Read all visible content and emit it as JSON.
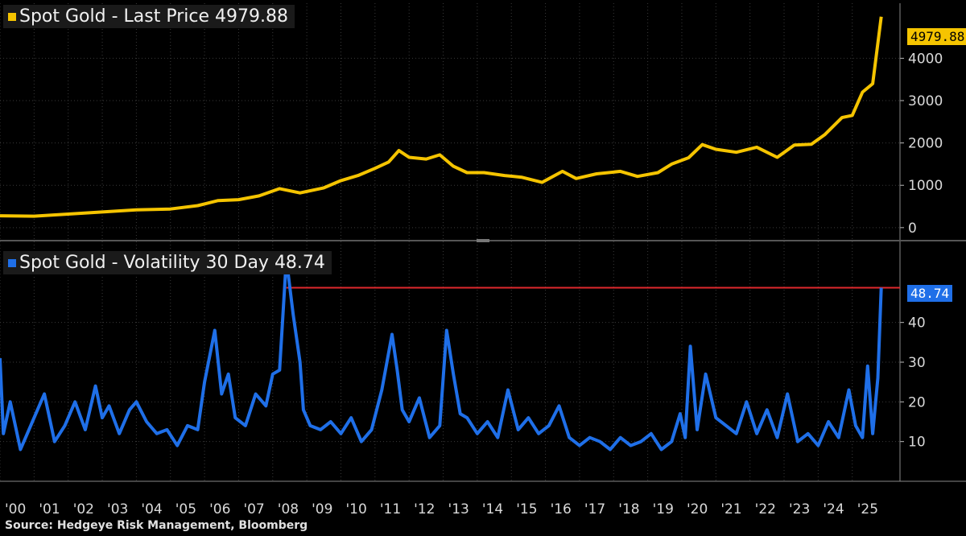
{
  "source_text": "Source: Hedgeye Risk Management, Bloomberg",
  "colors": {
    "background": "#000000",
    "gold": "#f5c400",
    "blue": "#1f6fe8",
    "reference_line": "#e0282d",
    "grid": "#3a3a3a",
    "tick_text": "#d9d9d9"
  },
  "chart_data": [
    {
      "type": "line",
      "legend": "Spot Gold - Last Price 4979.88",
      "last_value_label": "4979.88",
      "ylim": [
        -250,
        5300
      ],
      "yticks": [
        "0",
        "1000",
        "2000",
        "3000",
        "4000"
      ],
      "ytick_values": [
        0,
        1000,
        2000,
        3000,
        4000
      ],
      "series": [
        {
          "x": [
            2000.0,
            2001.0,
            2002.0,
            2003.0,
            2004.0,
            2005.0,
            2005.8,
            2006.4,
            2007.0,
            2007.6,
            2008.2,
            2008.8,
            2009.5,
            2010.0,
            2010.5,
            2011.0,
            2011.4,
            2011.7,
            2012.0,
            2012.5,
            2012.9,
            2013.3,
            2013.7,
            2014.2,
            2014.8,
            2015.3,
            2015.9,
            2016.5,
            2016.9,
            2017.5,
            2018.2,
            2018.7,
            2019.3,
            2019.7,
            2020.2,
            2020.6,
            2021.0,
            2021.6,
            2022.2,
            2022.8,
            2023.3,
            2023.8,
            2024.2,
            2024.7,
            2025.0,
            2025.3,
            2025.6,
            2025.85
          ],
          "values": [
            280,
            270,
            320,
            370,
            420,
            440,
            520,
            640,
            660,
            750,
            920,
            820,
            940,
            1110,
            1230,
            1400,
            1550,
            1820,
            1660,
            1620,
            1720,
            1450,
            1300,
            1300,
            1230,
            1190,
            1070,
            1330,
            1160,
            1270,
            1330,
            1210,
            1300,
            1500,
            1650,
            1960,
            1850,
            1780,
            1900,
            1660,
            1950,
            1970,
            2200,
            2600,
            2650,
            3200,
            3400,
            4979.88
          ]
        }
      ]
    },
    {
      "type": "line",
      "legend": "Spot Gold - Volatility 30 Day 48.74",
      "last_value_label": "48.74",
      "reference_value": 48.74,
      "ylim": [
        0,
        60
      ],
      "yticks": [
        "10",
        "20",
        "30",
        "40"
      ],
      "ytick_values": [
        10,
        20,
        30,
        40
      ],
      "xticks": [
        "'00",
        "'01",
        "'02",
        "'03",
        "'04",
        "'05",
        "'06",
        "'07",
        "'08",
        "'09",
        "'10",
        "'11",
        "'12",
        "'13",
        "'14",
        "'15",
        "'16",
        "'17",
        "'18",
        "'19",
        "'20",
        "'21",
        "'22",
        "'23",
        "'24",
        "'25"
      ],
      "xlim": [
        2000.0,
        2026.4
      ],
      "series": [
        {
          "x": [
            2000.0,
            2000.1,
            2000.3,
            2000.6,
            2000.8,
            2001.1,
            2001.3,
            2001.6,
            2001.9,
            2002.2,
            2002.5,
            2002.8,
            2003.0,
            2003.2,
            2003.5,
            2003.8,
            2004.0,
            2004.3,
            2004.6,
            2004.9,
            2005.2,
            2005.5,
            2005.8,
            2006.0,
            2006.3,
            2006.5,
            2006.7,
            2006.9,
            2007.2,
            2007.5,
            2007.8,
            2008.0,
            2008.2,
            2008.4,
            2008.6,
            2008.8,
            2008.9,
            2009.1,
            2009.4,
            2009.7,
            2010.0,
            2010.3,
            2010.6,
            2010.9,
            2011.2,
            2011.5,
            2011.65,
            2011.8,
            2012.0,
            2012.3,
            2012.6,
            2012.9,
            2013.1,
            2013.3,
            2013.5,
            2013.7,
            2014.0,
            2014.3,
            2014.6,
            2014.9,
            2015.2,
            2015.5,
            2015.8,
            2016.1,
            2016.4,
            2016.7,
            2017.0,
            2017.3,
            2017.6,
            2017.9,
            2018.2,
            2018.5,
            2018.8,
            2019.1,
            2019.4,
            2019.7,
            2019.95,
            2020.1,
            2020.25,
            2020.45,
            2020.7,
            2021.0,
            2021.3,
            2021.6,
            2021.9,
            2022.2,
            2022.5,
            2022.8,
            2023.1,
            2023.4,
            2023.7,
            2024.0,
            2024.3,
            2024.6,
            2024.9,
            2025.1,
            2025.3,
            2025.45,
            2025.6,
            2025.75,
            2025.85
          ],
          "values": [
            31,
            12,
            20,
            8,
            12,
            18,
            22,
            10,
            14,
            20,
            13,
            24,
            16,
            19,
            12,
            18,
            20,
            15,
            12,
            13,
            9,
            14,
            13,
            25,
            38,
            22,
            27,
            16,
            14,
            22,
            19,
            27,
            28,
            56,
            42,
            30,
            18,
            14,
            13,
            15,
            12,
            16,
            10,
            13,
            23,
            37,
            28,
            18,
            15,
            21,
            11,
            14,
            38,
            27,
            17,
            16,
            12,
            15,
            11,
            23,
            13,
            16,
            12,
            14,
            19,
            11,
            9,
            11,
            10,
            8,
            11,
            9,
            10,
            12,
            8,
            10,
            17,
            11,
            34,
            13,
            27,
            16,
            14,
            12,
            20,
            12,
            18,
            11,
            22,
            10,
            12,
            9,
            15,
            11,
            23,
            14,
            11,
            29,
            12,
            26,
            48.74
          ]
        }
      ]
    }
  ]
}
